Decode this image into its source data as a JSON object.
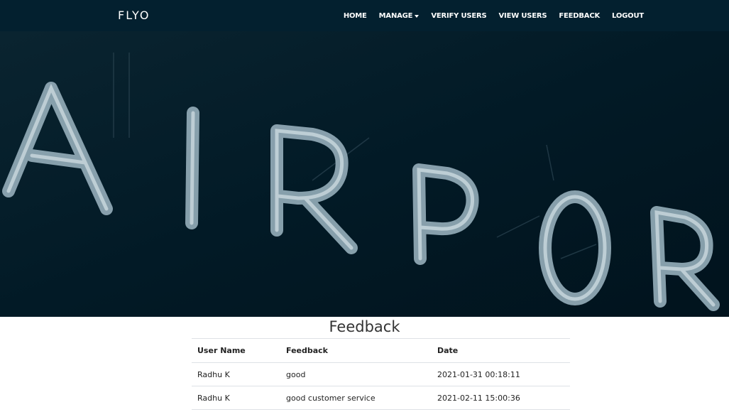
{
  "header": {
    "brand": "FLYO",
    "nav": {
      "home": "HOME",
      "manage": "MANAGE",
      "verify_users": "VERIFY USERS",
      "view_users": "VIEW USERS",
      "feedback": "FEEDBACK",
      "logout": "LOGOUT"
    }
  },
  "hero": {
    "sign_text": "AIRPOR",
    "background_color": "#011520",
    "letter_color": "#8ea7b3"
  },
  "main": {
    "title": "Feedback",
    "table": {
      "headers": [
        "User Name",
        "Feedback",
        "Date"
      ],
      "rows": [
        [
          "Radhu K",
          "good",
          "2021-01-31 00:18:11"
        ],
        [
          "Radhu K",
          "good customer service",
          "2021-02-11 15:00:36"
        ]
      ]
    }
  },
  "colors": {
    "navbar": "#03202f",
    "nav_text": "#ffffff"
  }
}
